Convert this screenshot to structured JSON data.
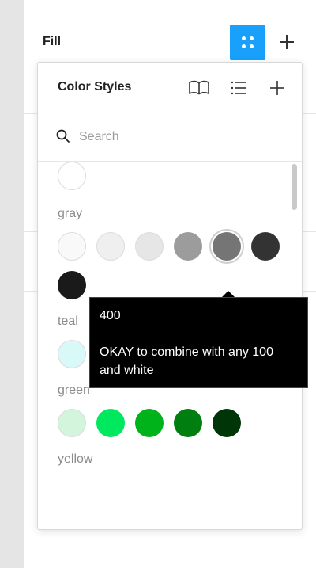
{
  "fill": {
    "title": "Fill",
    "styles_icon": "styles-grid-icon",
    "add_icon": "plus-icon",
    "accent_color": "#18a0fb"
  },
  "panel": {
    "title": "Color Styles",
    "icons": [
      "library-book-icon",
      "list-view-icon",
      "plus-icon"
    ],
    "search": {
      "placeholder": "Search",
      "value": ""
    }
  },
  "palette": {
    "top_swatch": "#ffffff",
    "sections": [
      {
        "label": "gray",
        "rows": [
          [
            "#f9f9f9",
            "#efefef",
            "#e6e6e6",
            "#9c9c9c",
            "#757575",
            "#333333"
          ],
          [
            "#1a1a1a"
          ]
        ]
      },
      {
        "label": "teal",
        "rows": [
          [
            "#d9f8f8",
            "#6ee8e8",
            "#00a0a8",
            "#006e80",
            "#00283a"
          ]
        ]
      },
      {
        "label": "green",
        "rows": [
          [
            "#d3f5dc",
            "#00e85e",
            "#00b31a",
            "#007f10",
            "#003508"
          ]
        ]
      },
      {
        "label": "yellow",
        "rows": []
      }
    ],
    "selected": "gray 400"
  },
  "tooltip": {
    "name": "400",
    "description_line1": "OKAY to combine with any 100",
    "description_line2": "and white"
  }
}
